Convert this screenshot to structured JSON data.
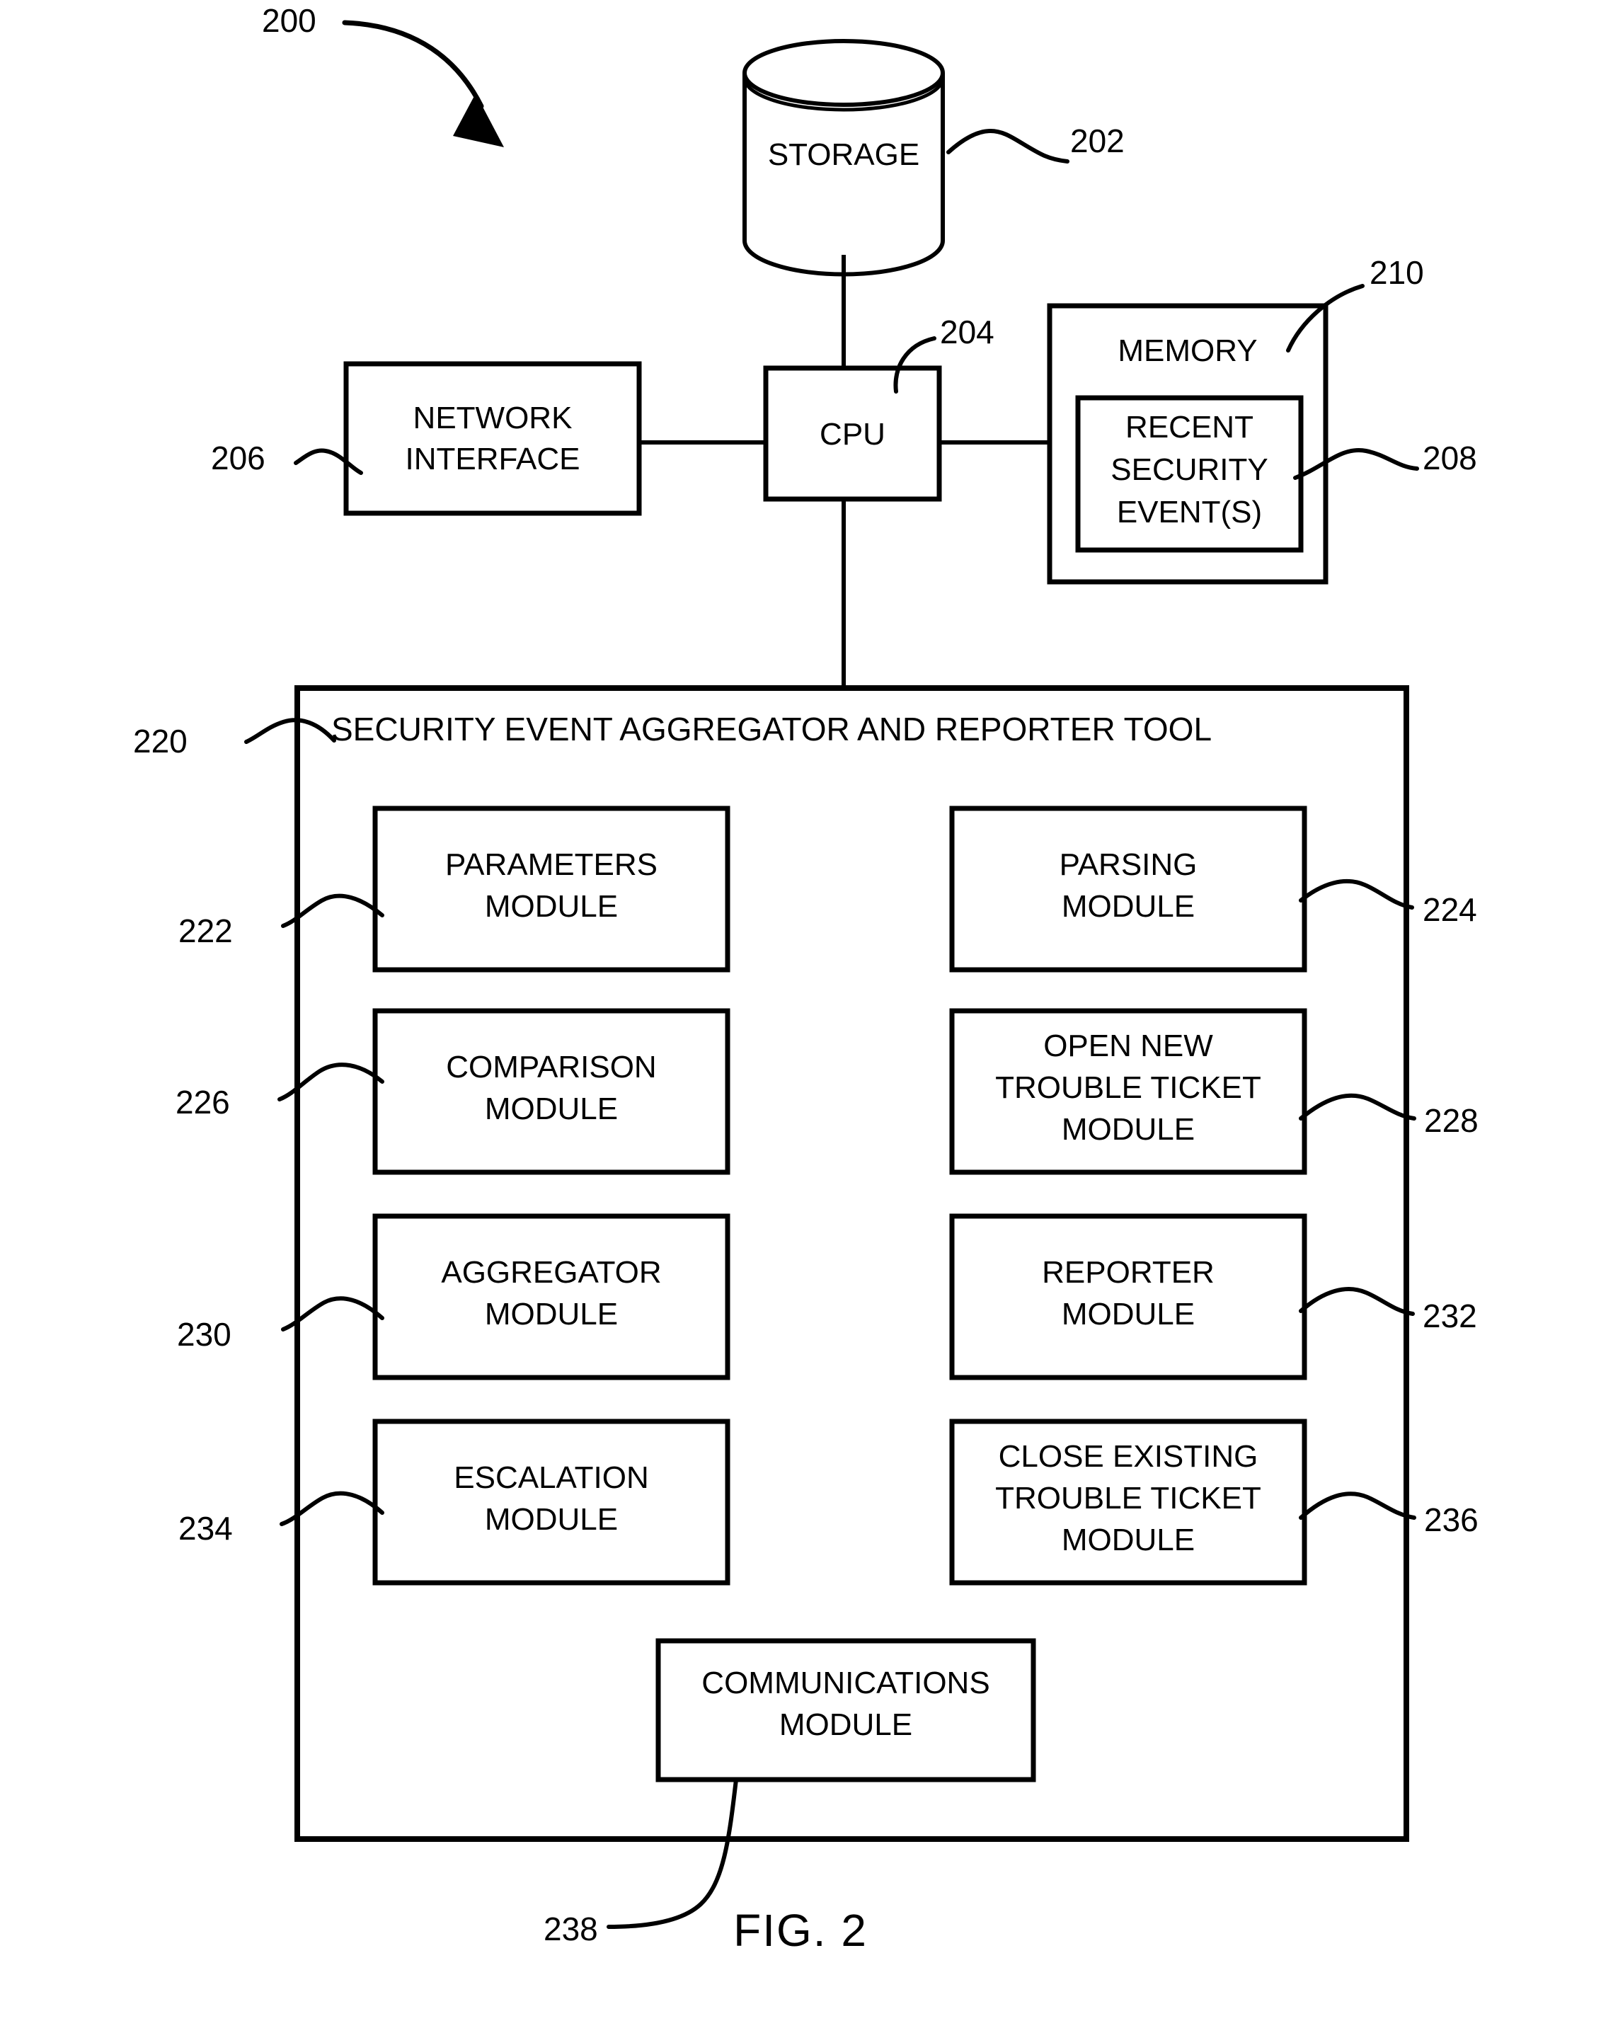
{
  "figure": {
    "caption": "FIG. 2",
    "system_ref": "200"
  },
  "nodes": {
    "storage": {
      "label": "STORAGE",
      "ref": "202",
      "shape": "cylinder"
    },
    "cpu": {
      "label": "CPU",
      "ref": "204",
      "shape": "rect"
    },
    "network_interface": {
      "label": "NETWORK\nINTERFACE",
      "line1": "NETWORK",
      "line2": "INTERFACE",
      "ref": "206",
      "shape": "rect"
    },
    "memory": {
      "label": "MEMORY",
      "ref": "210",
      "shape": "rect"
    },
    "recent_security_events": {
      "line1": "RECENT",
      "line2": "SECURITY",
      "line3": "EVENT(S)",
      "ref": "208",
      "shape": "rect"
    },
    "tool": {
      "label": "SECURITY EVENT AGGREGATOR AND REPORTER TOOL",
      "ref": "220",
      "shape": "rect"
    }
  },
  "modules": [
    {
      "ref": "222",
      "ref_side": "left",
      "lines": [
        "PARAMETERS",
        "MODULE"
      ],
      "column": "left",
      "row": 1
    },
    {
      "ref": "224",
      "ref_side": "right",
      "lines": [
        "PARSING",
        "MODULE"
      ],
      "column": "right",
      "row": 1
    },
    {
      "ref": "226",
      "ref_side": "left",
      "lines": [
        "COMPARISON",
        "MODULE"
      ],
      "column": "left",
      "row": 2
    },
    {
      "ref": "228",
      "ref_side": "right",
      "lines": [
        "OPEN NEW",
        "TROUBLE TICKET",
        "MODULE"
      ],
      "column": "right",
      "row": 2
    },
    {
      "ref": "230",
      "ref_side": "left",
      "lines": [
        "AGGREGATOR",
        "MODULE"
      ],
      "column": "left",
      "row": 3
    },
    {
      "ref": "232",
      "ref_side": "right",
      "lines": [
        "REPORTER",
        "MODULE"
      ],
      "column": "right",
      "row": 3
    },
    {
      "ref": "234",
      "ref_side": "left",
      "lines": [
        "ESCALATION",
        "MODULE"
      ],
      "column": "left",
      "row": 4
    },
    {
      "ref": "236",
      "ref_side": "right",
      "lines": [
        "CLOSE EXISTING",
        "TROUBLE TICKET",
        "MODULE"
      ],
      "column": "right",
      "row": 4
    },
    {
      "ref": "238",
      "ref_side": "bottom",
      "lines": [
        "COMMUNICATIONS",
        "MODULE"
      ],
      "column": "center",
      "row": 5
    }
  ],
  "module_text": {
    "m222_l1": "PARAMETERS",
    "m222_l2": "MODULE",
    "m224_l1": "PARSING",
    "m224_l2": "MODULE",
    "m226_l1": "COMPARISON",
    "m226_l2": "MODULE",
    "m228_l1": "OPEN NEW",
    "m228_l2": "TROUBLE TICKET",
    "m228_l3": "MODULE",
    "m230_l1": "AGGREGATOR",
    "m230_l2": "MODULE",
    "m232_l1": "REPORTER",
    "m232_l2": "MODULE",
    "m234_l1": "ESCALATION",
    "m234_l2": "MODULE",
    "m236_l1": "CLOSE EXISTING",
    "m236_l2": "TROUBLE TICKET",
    "m236_l3": "MODULE",
    "m238_l1": "COMMUNICATIONS",
    "m238_l2": "MODULE"
  },
  "refs": {
    "r200": "200",
    "r202": "202",
    "r204": "204",
    "r206": "206",
    "r208": "208",
    "r210": "210",
    "r220": "220",
    "r222": "222",
    "r224": "224",
    "r226": "226",
    "r228": "228",
    "r230": "230",
    "r232": "232",
    "r234": "234",
    "r236": "236",
    "r238": "238"
  },
  "colors": {
    "stroke": "#000000",
    "background": "#ffffff"
  }
}
